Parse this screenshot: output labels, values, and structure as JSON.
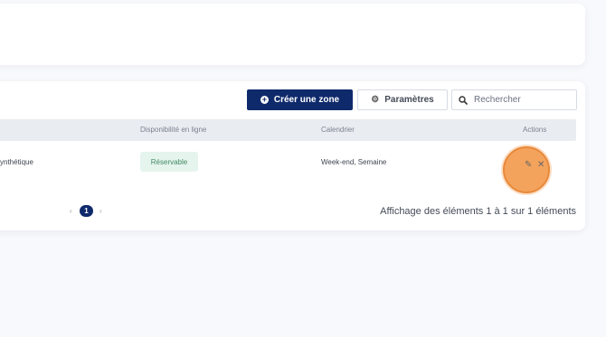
{
  "toolbar": {
    "create_label": "Créer une zone",
    "settings_label": "Paramètres"
  },
  "search": {
    "placeholder": "Rechercher"
  },
  "table": {
    "headers": [
      "Disponibilité en ligne",
      "Calendrier",
      "Actions"
    ],
    "rows": [
      {
        "name": "ynthétique",
        "availability": "Réservable",
        "calendar": "Week-end, Semaine"
      }
    ]
  },
  "pagination": {
    "prev": "‹",
    "current_page": "1",
    "next": "›",
    "info": "Affichage des éléments 1 à 1 sur 1 éléments"
  },
  "colors": {
    "primary": "#0f2a6b",
    "badge_bg": "#e6f4ee",
    "badge_text": "#3f8a61",
    "highlight": "#f4a35c"
  },
  "icons": {
    "create": "plus-circle-icon",
    "settings": "gear-icon",
    "search": "search-icon",
    "edit": "pencil-icon",
    "delete": "close-icon"
  }
}
